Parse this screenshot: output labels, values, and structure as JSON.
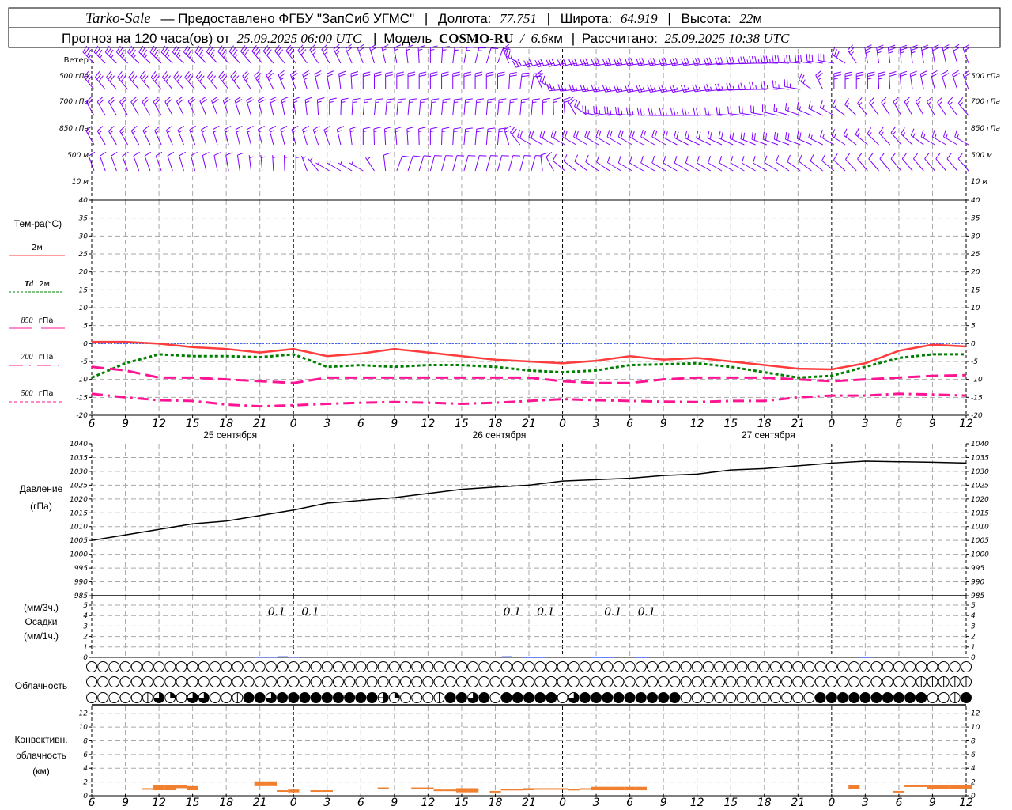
{
  "header": {
    "station": "Tarko-Sale",
    "provider": "— Предоставлено ФГБУ \"ЗапСиб УГМС\"",
    "lon_label": "Долгота:",
    "lon": "77.751",
    "lat_label": "Широта:",
    "lat": "64.919",
    "alt_label": "Высота:",
    "alt": "22",
    "alt_unit": "м",
    "forecast_label": "Прогноз на 120 часа(ов) от",
    "forecast_time": "25.09.2025 06:00 UTC",
    "model_label": "Модель",
    "model": "COSMO-RU",
    "res_sep": "/",
    "res": "6.6",
    "res_unit": "км",
    "calc_label": "Рассчитано:",
    "calc_time": "25.09.2025 10:38 UTC"
  },
  "time_axis": {
    "start": "2025-09-25T06:00",
    "end": "2025-09-28T12:00",
    "tick_labels": [
      "6",
      "9",
      "12",
      "15",
      "18",
      "21",
      "0",
      "3",
      "6",
      "9",
      "12",
      "15",
      "18",
      "21",
      "0",
      "3",
      "6",
      "9",
      "12",
      "15",
      "18",
      "21",
      "0",
      "3",
      "6",
      "9",
      "12"
    ],
    "day_labels": [
      "25 сентября",
      "26 сентября",
      "27 сентября"
    ]
  },
  "wind": {
    "title": "Ветер",
    "color": "#8000ff",
    "levels": [
      {
        "label": "500 гПа",
        "dir": [
          315,
          315,
          315,
          315,
          318,
          320,
          322,
          330,
          340,
          350,
          0,
          10,
          20,
          255,
          258,
          260,
          262,
          262,
          262,
          265,
          270,
          275,
          280,
          350,
          355,
          350,
          340
        ],
        "speed": [
          35,
          35,
          35,
          35,
          35,
          30,
          30,
          25,
          20,
          15,
          15,
          15,
          15,
          30,
          30,
          30,
          30,
          30,
          30,
          30,
          35,
          30,
          30,
          25,
          25,
          20,
          20
        ]
      },
      {
        "label": "700 гПа",
        "dir": [
          320,
          320,
          320,
          320,
          322,
          330,
          340,
          350,
          0,
          0,
          0,
          0,
          0,
          10,
          265,
          262,
          260,
          260,
          260,
          265,
          270,
          280,
          0,
          0,
          355,
          345,
          340
        ],
        "speed": [
          30,
          30,
          30,
          30,
          30,
          25,
          25,
          20,
          20,
          20,
          20,
          20,
          20,
          20,
          25,
          25,
          25,
          25,
          25,
          25,
          25,
          25,
          25,
          25,
          20,
          20,
          20
        ]
      },
      {
        "label": "850 гПа",
        "dir": [
          330,
          330,
          330,
          335,
          340,
          345,
          350,
          0,
          5,
          5,
          5,
          5,
          5,
          5,
          355,
          280,
          275,
          270,
          270,
          275,
          280,
          290,
          300,
          320,
          330,
          330,
          320
        ],
        "speed": [
          20,
          20,
          20,
          20,
          20,
          20,
          15,
          15,
          15,
          15,
          15,
          15,
          15,
          15,
          15,
          25,
          25,
          25,
          25,
          20,
          20,
          15,
          15,
          15,
          15,
          15,
          15
        ]
      },
      {
        "label": "500 м",
        "dir": [
          330,
          330,
          335,
          340,
          345,
          345,
          345,
          340,
          0,
          355,
          0,
          5,
          5,
          300,
          300,
          300,
          300,
          300,
          295,
          295,
          290,
          290,
          300,
          310,
          320,
          300,
          300
        ],
        "speed": [
          15,
          15,
          15,
          15,
          15,
          15,
          15,
          15,
          15,
          15,
          15,
          15,
          15,
          20,
          20,
          20,
          20,
          20,
          20,
          20,
          20,
          20,
          15,
          15,
          15,
          15,
          15
        ]
      },
      {
        "label": "10  м",
        "dir": [
          340,
          340,
          340,
          345,
          350,
          355,
          360,
          300,
          300,
          20,
          15,
          15,
          15,
          15,
          310,
          305,
          300,
          300,
          300,
          300,
          300,
          305,
          310,
          320,
          320,
          320,
          320
        ],
        "speed": [
          10,
          10,
          10,
          10,
          10,
          5,
          5,
          5,
          5,
          10,
          10,
          10,
          10,
          10,
          10,
          10,
          10,
          10,
          10,
          10,
          10,
          10,
          10,
          10,
          10,
          10,
          10
        ]
      }
    ]
  },
  "temperature": {
    "title": "Тем-ра(°C)",
    "ylim": [
      -20,
      40
    ],
    "ticks": [
      "40",
      "35",
      "30",
      "25",
      "20",
      "15",
      "10",
      "5",
      "0",
      "-5",
      "-10",
      "-15",
      "-20"
    ],
    "series": [
      {
        "name": "2м",
        "color": "#ff3c3c",
        "values": [
          0.5,
          0.5,
          0,
          -1,
          -1.5,
          -2.5,
          -1.5,
          -3.5,
          -2.8,
          -1.5,
          -2.5,
          -3.5,
          -4.5,
          -5,
          -5.5,
          -4.8,
          -3.5,
          -4.5,
          -4,
          -5,
          -6,
          -7,
          -7.2,
          -5.5,
          -2,
          -0.3,
          -0.8
        ]
      },
      {
        "name": "Td",
        "name_suffix": "2м",
        "color": "#008000",
        "values": [
          -9.5,
          -5.5,
          -3,
          -3.5,
          -3.5,
          -3.8,
          -3,
          -6.5,
          -6,
          -6.5,
          -6,
          -6,
          -6.5,
          -7.5,
          -8,
          -7.5,
          -6,
          -5.8,
          -5.5,
          -6.5,
          -8,
          -9.5,
          -9,
          -6.5,
          -4,
          -3,
          -3
        ]
      },
      {
        "name": "850",
        "name_suffix": "гПа",
        "color": "#ff1493",
        "values": [
          -6.5,
          -7.5,
          -9.5,
          -9.5,
          -10,
          -10.5,
          -11,
          -9.5,
          -9.5,
          -9.5,
          -9.5,
          -9.5,
          -9.5,
          -9.5,
          -10.5,
          -11,
          -11,
          -10,
          -9.5,
          -9.5,
          -9.5,
          -10,
          -10.5,
          -10,
          -9.5,
          -9,
          -8.8
        ]
      },
      {
        "name": "700",
        "name_suffix": "гПа",
        "color": "#ff1493",
        "values": [
          -14,
          -15,
          -15.8,
          -16,
          -17,
          -17.5,
          -17.2,
          -16.8,
          -16.5,
          -16.3,
          -16.5,
          -16.8,
          -16.5,
          -16,
          -15.5,
          -15.8,
          -16,
          -16.2,
          -16.3,
          -16,
          -16,
          -15,
          -14.5,
          -14.5,
          -14,
          -14.2,
          -14.5
        ]
      },
      {
        "name": "500",
        "name_suffix": "гПа",
        "color": "#ff1493",
        "values": []
      }
    ]
  },
  "pressure": {
    "title": "Давление",
    "unit": "(гПа)",
    "ylim": [
      985,
      1040
    ],
    "ticks": [
      "1040",
      "1035",
      "1030",
      "1025",
      "1020",
      "1015",
      "1010",
      "1005",
      "1000",
      "995",
      "990",
      "985"
    ],
    "color": "#000000",
    "values": [
      1005,
      1007,
      1009,
      1011,
      1012,
      1014,
      1016,
      1018.5,
      1019.5,
      1020.5,
      1022,
      1023.5,
      1024.3,
      1025,
      1026.5,
      1027,
      1027.5,
      1028.5,
      1029,
      1030.5,
      1031,
      1032,
      1033,
      1033.7,
      1033.5,
      1033.3,
      1033
    ]
  },
  "precipitation": {
    "unit_3h": "(мм/3ч.)",
    "title": "Осадки",
    "unit_1h": "(мм/1ч.)",
    "ylim": [
      0,
      5
    ],
    "ticks": [
      "5",
      "4",
      "3",
      "2",
      "1",
      "0"
    ],
    "color": "#0030ff",
    "hourly": [
      {
        "time": "2025-09-25T21:00",
        "value": 0.05
      },
      {
        "time": "2025-09-25T22:00",
        "value": 0.05
      },
      {
        "time": "2025-09-25T23:00",
        "value": 0.1
      },
      {
        "time": "2025-09-26T00:00",
        "value": 0.05
      },
      {
        "time": "2025-09-26T19:00",
        "value": 0.1
      },
      {
        "time": "2025-09-26T21:00",
        "value": 0.03
      },
      {
        "time": "2025-09-26T22:00",
        "value": 0.03
      },
      {
        "time": "2025-09-27T03:00",
        "value": 0.03
      },
      {
        "time": "2025-09-27T04:00",
        "value": 0.03
      },
      {
        "time": "2025-09-27T07:00",
        "value": 0.03
      },
      {
        "time": "2025-09-28T03:00",
        "value": 0.03
      }
    ],
    "three_hour_labels": [
      {
        "time": "2025-09-25T22:30",
        "value": "0.1"
      },
      {
        "time": "2025-09-26T01:30",
        "value": "0.1"
      },
      {
        "time": "2025-09-26T19:30",
        "value": "0.1"
      },
      {
        "time": "2025-09-26T22:30",
        "value": "0.1"
      },
      {
        "time": "2025-09-27T04:30",
        "value": "0.1"
      },
      {
        "time": "2025-09-27T07:30",
        "value": "0.1"
      }
    ]
  },
  "cloudiness": {
    "title": "Облачность",
    "rows_eighths": [
      [
        0,
        0,
        0,
        0,
        0,
        0,
        0,
        0,
        0,
        0,
        0,
        0,
        0,
        0,
        0,
        0,
        0,
        0,
        0,
        0,
        0,
        0,
        0,
        0,
        0,
        0,
        0,
        0,
        0,
        0,
        0,
        0,
        0,
        0,
        0,
        0,
        0,
        0,
        0,
        0,
        0,
        0,
        0,
        0,
        0,
        0,
        0,
        0,
        0,
        0,
        0,
        0,
        0,
        0,
        0,
        0,
        0,
        0,
        0,
        0,
        0,
        0,
        0,
        0,
        0,
        0,
        0,
        0,
        0,
        0,
        0,
        0,
        0,
        0,
        0,
        0,
        0,
        0,
        0
      ],
      [
        0,
        0,
        0,
        0,
        0,
        0,
        0,
        0,
        0,
        0,
        0,
        0,
        0,
        0,
        0,
        0,
        0,
        0,
        0,
        0,
        0,
        0,
        0,
        0,
        0,
        0,
        0,
        0,
        0,
        0,
        0,
        0,
        0,
        0,
        0,
        0,
        0,
        0,
        0,
        0,
        0,
        0,
        0,
        0,
        0,
        0,
        0,
        0,
        0,
        0,
        0,
        0,
        0,
        0,
        0,
        0,
        0,
        0,
        0,
        0,
        0,
        0,
        0,
        0,
        0,
        0,
        0,
        0,
        0,
        0,
        0,
        0,
        0,
        0,
        1,
        1,
        1,
        1,
        1
      ],
      [
        0,
        0,
        0,
        0,
        0,
        1,
        6,
        2,
        0,
        6,
        6,
        0,
        0,
        1,
        8,
        8,
        6,
        8,
        8,
        8,
        8,
        8,
        8,
        8,
        8,
        8,
        4,
        2,
        0,
        0,
        0,
        1,
        8,
        8,
        6,
        8,
        0,
        8,
        8,
        8,
        8,
        8,
        0,
        6,
        8,
        8,
        8,
        8,
        8,
        8,
        8,
        8,
        8,
        0,
        0,
        0,
        0,
        0,
        0,
        0,
        0,
        0,
        0,
        0,
        0,
        8,
        8,
        8,
        8,
        8,
        8,
        8,
        8,
        8,
        8,
        0,
        0,
        1,
        8
      ]
    ]
  },
  "convective": {
    "title": "Конвективн.",
    "title2": "облачность",
    "unit": "(км)",
    "ylim": [
      0,
      13
    ],
    "ticks": [
      "12",
      "10",
      "8",
      "6",
      "4",
      "2",
      "0"
    ],
    "color": "#f08030",
    "bars": [
      {
        "time": "2025-09-25T11:00",
        "base": 0.9,
        "top": 1.1
      },
      {
        "time": "2025-09-25T12:00",
        "base": 0.8,
        "top": 1.5
      },
      {
        "time": "2025-09-25T13:00",
        "base": 0.8,
        "top": 1.5
      },
      {
        "time": "2025-09-25T14:00",
        "base": 1.1,
        "top": 1.5
      },
      {
        "time": "2025-09-25T15:00",
        "base": 0.8,
        "top": 1.4
      },
      {
        "time": "2025-09-25T21:00",
        "base": 1.4,
        "top": 2.1
      },
      {
        "time": "2025-09-25T22:00",
        "base": 1.4,
        "top": 2.1
      },
      {
        "time": "2025-09-25T23:00",
        "base": 0.6,
        "top": 0.8
      },
      {
        "time": "2025-09-26T00:00",
        "base": 0.5,
        "top": 0.9
      },
      {
        "time": "2025-09-26T02:00",
        "base": 0.6,
        "top": 0.8
      },
      {
        "time": "2025-09-26T03:00",
        "base": 0.6,
        "top": 0.8
      },
      {
        "time": "2025-09-26T08:00",
        "base": 1.0,
        "top": 1.2
      },
      {
        "time": "2025-09-26T11:00",
        "base": 1.0,
        "top": 1.2
      },
      {
        "time": "2025-09-26T12:00",
        "base": 1.0,
        "top": 1.2
      },
      {
        "time": "2025-09-26T13:00",
        "base": 0.7,
        "top": 0.9
      },
      {
        "time": "2025-09-26T14:00",
        "base": 0.7,
        "top": 0.9
      },
      {
        "time": "2025-09-26T15:00",
        "base": 0.5,
        "top": 1.1
      },
      {
        "time": "2025-09-26T16:00",
        "base": 0.5,
        "top": 1.1
      },
      {
        "time": "2025-09-26T18:00",
        "base": 0.5,
        "top": 0.7
      },
      {
        "time": "2025-09-26T19:00",
        "base": 0.8,
        "top": 1.0
      },
      {
        "time": "2025-09-26T20:00",
        "base": 0.8,
        "top": 1.0
      },
      {
        "time": "2025-09-26T21:00",
        "base": 0.8,
        "top": 1.1
      },
      {
        "time": "2025-09-26T22:00",
        "base": 0.9,
        "top": 1.1
      },
      {
        "time": "2025-09-26T23:00",
        "base": 0.9,
        "top": 1.1
      },
      {
        "time": "2025-09-27T00:00",
        "base": 0.9,
        "top": 1.1
      },
      {
        "time": "2025-09-27T01:00",
        "base": 0.9,
        "top": 1.0
      },
      {
        "time": "2025-09-27T02:00",
        "base": 0.9,
        "top": 1.1
      },
      {
        "time": "2025-09-27T03:00",
        "base": 0.8,
        "top": 1.3
      },
      {
        "time": "2025-09-27T04:00",
        "base": 0.8,
        "top": 1.3
      },
      {
        "time": "2025-09-27T05:00",
        "base": 0.8,
        "top": 1.3
      },
      {
        "time": "2025-09-27T06:00",
        "base": 0.8,
        "top": 1.3
      },
      {
        "time": "2025-09-27T07:00",
        "base": 0.8,
        "top": 1.3
      },
      {
        "time": "2025-09-28T02:00",
        "base": 1.0,
        "top": 1.6
      },
      {
        "time": "2025-09-28T06:00",
        "base": 0.5,
        "top": 0.7
      },
      {
        "time": "2025-09-28T07:00",
        "base": 1.3,
        "top": 1.5
      },
      {
        "time": "2025-09-28T08:00",
        "base": 1.3,
        "top": 1.5
      },
      {
        "time": "2025-09-28T09:00",
        "base": 1.0,
        "top": 1.5
      },
      {
        "time": "2025-09-28T10:00",
        "base": 1.0,
        "top": 1.5
      },
      {
        "time": "2025-09-28T11:00",
        "base": 1.0,
        "top": 1.5
      },
      {
        "time": "2025-09-28T12:00",
        "base": 1.0,
        "top": 1.5
      }
    ]
  }
}
